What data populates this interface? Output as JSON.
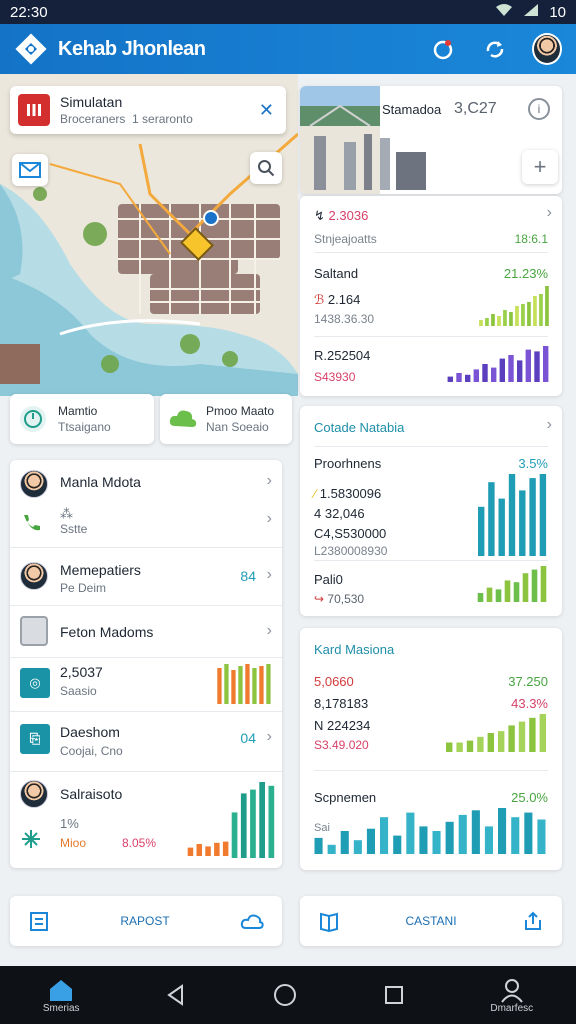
{
  "status": {
    "time": "22:30",
    "battery": "10"
  },
  "appbar": {
    "title": "Kehab Jhonlean"
  },
  "search_card": {
    "title": "Simulatan",
    "subtitle": "Broceraners",
    "subtitle2": "1 seraronto"
  },
  "places": [
    {
      "name": "Mamtio",
      "sub": "Ttsaigano"
    },
    {
      "name": "Pmoo",
      "sub": "Nan",
      "extra": "Maato",
      "extra_sub": "Soeaio"
    }
  ],
  "list": [
    {
      "name": "Manla Mdota",
      "sub": "Sstte",
      "value": "",
      "icon": "person"
    },
    {
      "name": "Memepatiers",
      "sub": "Pe Deim",
      "value": "84",
      "icon": "person"
    },
    {
      "name": "Feton Madoms",
      "sub": "",
      "value": "",
      "icon": "device"
    },
    {
      "name": "2,5037",
      "sub": "Saasio",
      "value": "",
      "icon": "tile"
    },
    {
      "name": "Daeshom",
      "sub": "Coojai, Cno",
      "value": "04",
      "icon": "tile2"
    },
    {
      "name": "Salraisoto",
      "sub": "",
      "value": "",
      "icon": "person"
    }
  ],
  "list_footer": {
    "percent_label": "1%",
    "bars_label": "Mioo",
    "pct": "8.05%"
  },
  "photo_card": {
    "title": "Stamadoa",
    "value": "3,C27"
  },
  "stats_card1": {
    "head_value": "2.3036",
    "head_sub": "Stnjeajoatts",
    "head_right": "18:6.1",
    "sec1_label": "Saltand",
    "sec1_pct": "21.23%",
    "sec1_v1": "2.164",
    "sec1_v2": "1438.36.30",
    "sec2_label": "R.252504",
    "sec2_v": "S43930"
  },
  "stats_card2": {
    "title": "Cotade Natabia",
    "row1_label": "Proorhnens",
    "row1_pct": "3.5%",
    "row1_v1": "1.5830096",
    "row1_v2": "4 32,046",
    "row1_v3": "C4,S530000",
    "row1_v4": "L2380008930",
    "row2_label": "Pali0",
    "row2_v": "70,530"
  },
  "stats_card3": {
    "title": "Kard Masiona",
    "r1_v": "5,0660",
    "r1_pct": "37.250",
    "r2_v": "8,178183",
    "r2_pct": "43.3%",
    "r3_v": "N 224234",
    "r3_sub": "S3.49.020",
    "r4_label": "Scpnemen",
    "r4_pct": "25.0%",
    "r4_sub": "Sai"
  },
  "bottom_buttons": [
    {
      "label": "RAPOST"
    },
    {
      "label": "CASTANI"
    }
  ],
  "navbar": {
    "home_label": "Smerias",
    "profile_label": "Dmarfesc"
  },
  "bars": {
    "card1_green": [
      0.15,
      0.2,
      0.3,
      0.25,
      0.4,
      0.35,
      0.5,
      0.55,
      0.6,
      0.75,
      0.8,
      1.0
    ],
    "card1_purple": [
      0.15,
      0.25,
      0.2,
      0.35,
      0.5,
      0.4,
      0.65,
      0.75,
      0.6,
      0.9,
      0.85,
      1.0
    ],
    "card2_teal": [
      0.6,
      0.9,
      0.7,
      1.0,
      0.8,
      0.95,
      1.0
    ],
    "card2_green": [
      0.25,
      0.4,
      0.35,
      0.6,
      0.55,
      0.8,
      0.9,
      1.0
    ],
    "card3_green": [
      0.25,
      0.25,
      0.3,
      0.4,
      0.5,
      0.55,
      0.7,
      0.8,
      0.9,
      1.0
    ],
    "card3_teal": [
      0.35,
      0.2,
      0.5,
      0.3,
      0.55,
      0.8,
      0.4,
      0.9,
      0.6,
      0.5,
      0.7,
      0.85,
      0.95,
      0.6,
      1.0,
      0.8,
      0.9,
      0.75
    ],
    "list_orange": [
      0.9,
      1.0,
      0.85,
      0.95,
      1.0,
      0.9,
      0.95,
      1.0
    ],
    "list_teal": [
      0.6,
      0.85,
      0.9,
      1.0,
      0.95
    ],
    "list_orange2": [
      0.35,
      0.5,
      0.4,
      0.55,
      0.6
    ]
  },
  "colors": {
    "accent": "#1a87d8",
    "teal": "#1f9db5",
    "green": "#8cc43f",
    "purple": "#5b3fbf",
    "orange": "#f07a2e"
  }
}
